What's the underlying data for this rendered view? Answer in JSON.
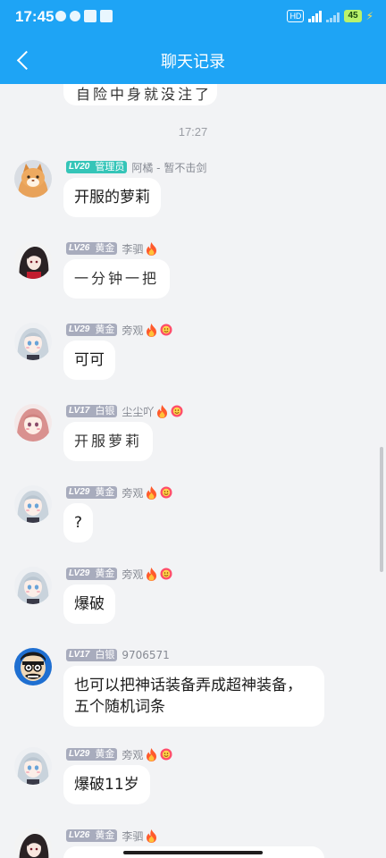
{
  "status_bar": {
    "time": "17:45",
    "network": "HD",
    "battery": "45",
    "colors": {
      "bar": "#1ea4f5",
      "battery": "#b9f26b"
    }
  },
  "nav": {
    "title": "聊天记录",
    "back_icon": "chevron-left-icon"
  },
  "previous_message": {
    "text": "自险中身就没注了"
  },
  "timestamp": "17:27",
  "messages": [
    {
      "level": "LV20",
      "rank": "管理员",
      "nickname": "阿橘 - 暂不击剑",
      "badge_color": "#35c5b8",
      "text": "开服的萝莉",
      "avatar": "orange-cat-avatar"
    },
    {
      "level": "LV26",
      "rank": "黄金",
      "nickname": "李驷",
      "badge_color": "#a8acbd",
      "text": "一分钟一把",
      "avatar": "dark-anime-avatar",
      "handwritten": true
    },
    {
      "level": "LV29",
      "rank": "黄金",
      "nickname": "旁观",
      "badge_color": "#a8acbd",
      "text": "可可",
      "avatar": "silver-hair-avatar"
    },
    {
      "level": "LV17",
      "rank": "白银",
      "nickname": "尘尘吖",
      "badge_color": "#a8acbd",
      "text": "开服萝莉",
      "avatar": "pink-hair-avatar",
      "handwritten": true
    },
    {
      "level": "LV29",
      "rank": "黄金",
      "nickname": "旁观",
      "badge_color": "#a8acbd",
      "text": "?",
      "avatar": "silver-hair-avatar"
    },
    {
      "level": "LV29",
      "rank": "黄金",
      "nickname": "旁观",
      "badge_color": "#a8acbd",
      "text": "爆破",
      "avatar": "silver-hair-avatar"
    },
    {
      "level": "LV17",
      "rank": "白银",
      "nickname": "9706571",
      "badge_color": "#a8acbd",
      "text": "也可以把神话装备弄成超神装备，五个随机词条",
      "avatar": "cartoon-man-avatar"
    },
    {
      "level": "LV29",
      "rank": "黄金",
      "nickname": "旁观",
      "badge_color": "#a8acbd",
      "text": "爆破11岁",
      "avatar": "silver-hair-avatar"
    },
    {
      "level": "LV26",
      "rank": "黄金",
      "nickname": "李驷",
      "badge_color": "#a8acbd",
      "text": "",
      "avatar": "dark-anime-avatar"
    }
  ]
}
